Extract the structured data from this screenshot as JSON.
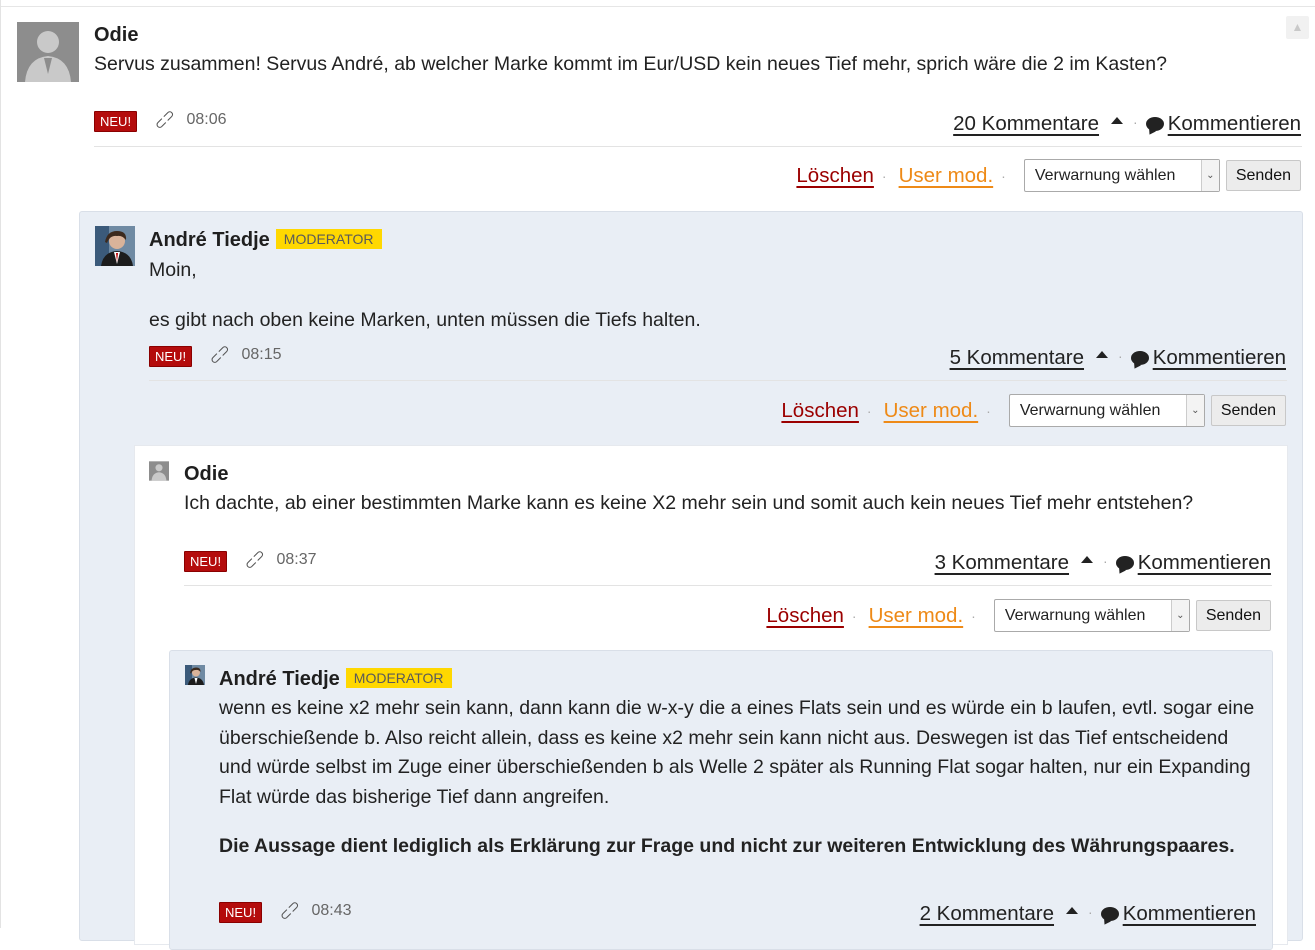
{
  "report_icon": "warning-icon",
  "mod_controls": {
    "delete": "Löschen",
    "user_mod": "User mod.",
    "warn_select": "Verwarnung wählen",
    "send": "Senden"
  },
  "actions": {
    "comment": "Kommentieren"
  },
  "posts": [
    {
      "author": "Odie",
      "avatar": "default-avatar",
      "text": "Servus zusammen! Servus André, ab welcher Marke kommt im Eur/USD kein neues Tief mehr, sprich wäre die 2 im Kasten?",
      "new_label": "NEU!",
      "time": "08:06",
      "comments": "20 Kommentare"
    },
    {
      "author": "André Tiedje",
      "badge": "MODERATOR",
      "avatar": "photo-avatar",
      "text_lines": [
        "Moin,",
        "es gibt nach oben keine Marken, unten müssen die Tiefs halten."
      ],
      "new_label": "NEU!",
      "time": "08:15",
      "comments": "5 Kommentare"
    },
    {
      "author": "Odie",
      "avatar": "default-avatar",
      "text": "Ich dachte, ab einer bestimmten Marke kann es keine X2 mehr sein und somit auch kein neues Tief mehr entstehen?",
      "new_label": "NEU!",
      "time": "08:37",
      "comments": "3 Kommentare"
    },
    {
      "author": "André Tiedje",
      "badge": "MODERATOR",
      "avatar": "photo-avatar",
      "text": "wenn es keine x2 mehr sein kann, dann kann die w-x-y die a eines Flats sein und es würde ein b laufen, evtl. sogar eine überschießende b. Also reicht allein, dass es keine x2 mehr sein kann nicht aus. Deswegen ist das Tief entscheidend und würde selbst im Zuge einer überschießenden b als Welle 2 später als Running Flat sogar halten, nur ein Expanding Flat würde das bisherige Tief dann angreifen.",
      "bold_text": "Die Aussage dient lediglich als Erklärung zur Frage und nicht zur weiteren Entwicklung des Währungspaares.",
      "new_label": "NEU!",
      "time": "08:43",
      "comments": "2 Kommentare"
    }
  ]
}
